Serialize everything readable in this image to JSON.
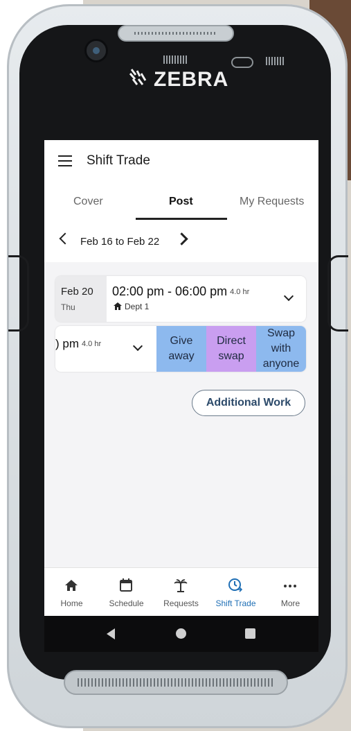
{
  "device": {
    "brand": "ZEBRA"
  },
  "app": {
    "title": "Shift Trade"
  },
  "tabs": [
    {
      "label": "Cover"
    },
    {
      "label": "Post"
    },
    {
      "label": "My Requests"
    }
  ],
  "date_range": "Feb 16 to Feb 22",
  "shift": {
    "date": "Feb 20",
    "day": "Thu",
    "time": "02:00 pm - 06:00 pm",
    "hours": "4.0 hr",
    "dept": "Dept 1"
  },
  "swipe_row": {
    "partial_time": ") pm",
    "hours": "4.0 hr",
    "actions": {
      "give_away": "Give away",
      "direct_swap": "Direct swap",
      "swap_anyone": "Swap with anyone"
    }
  },
  "additional_work": "Additional Work",
  "bottom_nav": [
    {
      "label": "Home",
      "icon": "home-icon"
    },
    {
      "label": "Schedule",
      "icon": "calendar-icon"
    },
    {
      "label": "Requests",
      "icon": "palm-tree-icon"
    },
    {
      "label": "Shift Trade",
      "icon": "clock-swap-icon",
      "active": true
    },
    {
      "label": "More",
      "icon": "more-dots-icon"
    }
  ],
  "colors": {
    "give": "#8db9ee",
    "direct": "#c99ef0",
    "active_nav": "#1f6fb5"
  }
}
